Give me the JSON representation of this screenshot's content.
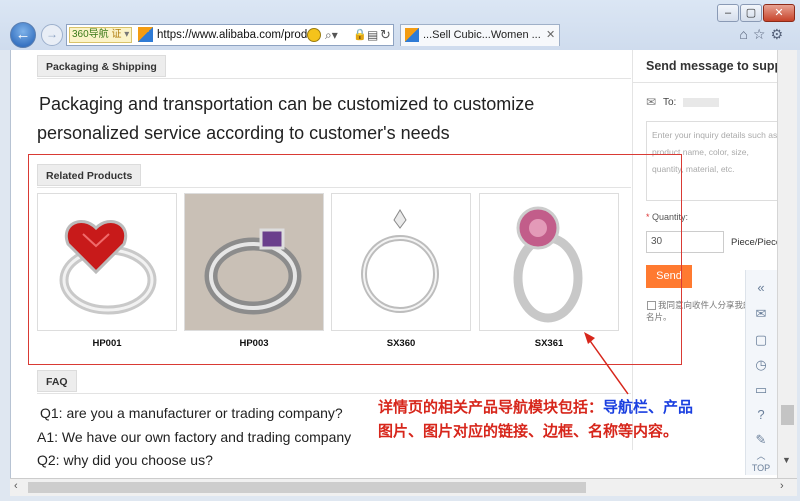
{
  "browser": {
    "window_controls": [
      "–",
      "▢",
      "✕"
    ],
    "nav_badge": "360导航",
    "nav_badge_extra": "证",
    "url": "https://www.alibaba.com/produ",
    "tab_title": "...Sell Cubic...Women ...",
    "tab_close": "✕"
  },
  "page": {
    "packaging_tab": "Packaging & Shipping",
    "packaging_text_line1": "Packaging and transportation can be customized to customize",
    "packaging_text_line2": "personalized service according to customer's needs",
    "related_tab": "Related Products",
    "products": [
      {
        "name": "HP001",
        "icon": "red-heart-ring-icon"
      },
      {
        "name": "HP003",
        "icon": "purple-gem-band-ring-icon"
      },
      {
        "name": "SX360",
        "icon": "solitaire-ring-icon"
      },
      {
        "name": "SX361",
        "icon": "pink-gem-ring-icon"
      }
    ],
    "faq_tab": "FAQ",
    "faq_lines": [
      "Q1: are you a manufacturer or trading company?",
      "A1: We have our own factory and trading company",
      "Q2: why did you choose us?"
    ]
  },
  "message_panel": {
    "title": "Send message to supp",
    "to_label": "To:",
    "inquiry_placeholder": "Enter your inquiry details such as product name, color, size, quantity, material, etc.",
    "quantity_label": "Quantity:",
    "required_mark": "*",
    "quantity_value": "30",
    "unit": "Piece/Piece",
    "send_button": "Send",
    "agree_text": "我同意向收件人分享我的名片。"
  },
  "annotation": {
    "line1_prefix": "详情页的相关产品导航模块包括：",
    "line1_blue": "导航栏、产品",
    "line2": "图片、图片对应的链接、边框、名称等内容。"
  },
  "sidebar": {
    "top_label": "TOP"
  },
  "colors": {
    "annotation_red": "#d7261b",
    "annotation_blue": "#1a3fe0",
    "send_orange": "#ff7a30"
  }
}
